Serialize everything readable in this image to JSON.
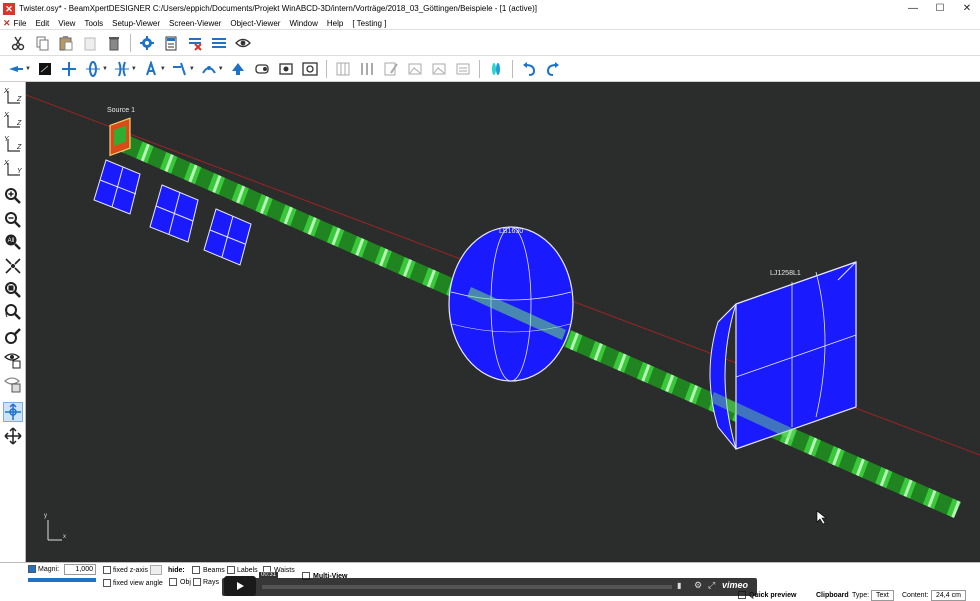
{
  "window": {
    "title": "Twister.osy* - BeamXpertDESIGNER C:/Users/eppich/Documents/Projekt WinABCD-3D/intern/Vorträge/2018_03_Göttingen/Beispiele - [1 (active)]",
    "minimize": "—",
    "maximize": "☐",
    "close": "✕"
  },
  "menu": [
    "File",
    "Edit",
    "View",
    "Tools",
    "Setup-Viewer",
    "Screen-Viewer",
    "Object-Viewer",
    "Window",
    "Help",
    "[ Testing ]"
  ],
  "viewport": {
    "labels": {
      "source": "Source 1",
      "lens1": "LB1630",
      "lens2": "LJ1258L1"
    },
    "axis_x": "x",
    "axis_y": "y"
  },
  "lefttools": {
    "view_zx": [
      "X",
      "Z"
    ],
    "view_xz": [
      "X",
      "Z"
    ],
    "view_yz": [
      "Y",
      "Z"
    ],
    "view_xy": [
      "X",
      "Y"
    ]
  },
  "bottom": {
    "magni_label": "Magni:",
    "magni_value": "1,000",
    "fixed_z": "fixed z-axis",
    "fixed_view": "fixed view angle",
    "hide": "hide:",
    "beams": "Beams",
    "labels": "Labels",
    "waists": "Waists",
    "obj": "Obj",
    "rays": "Rays",
    "multiview": "Multi-View",
    "quick_preview": "Quick preview",
    "clipboard": "Clipboard",
    "type_label": "Type:",
    "type_value": "Text",
    "content_label": "Content:",
    "content_value": "24,4 cm"
  },
  "video": {
    "time": "00:31",
    "brand": "vimeo"
  },
  "colors": {
    "viewport_bg": "#2b2d2c",
    "beam": "#2fbf2f",
    "optic": "#1a1aff",
    "accent": "#1e72c8"
  }
}
